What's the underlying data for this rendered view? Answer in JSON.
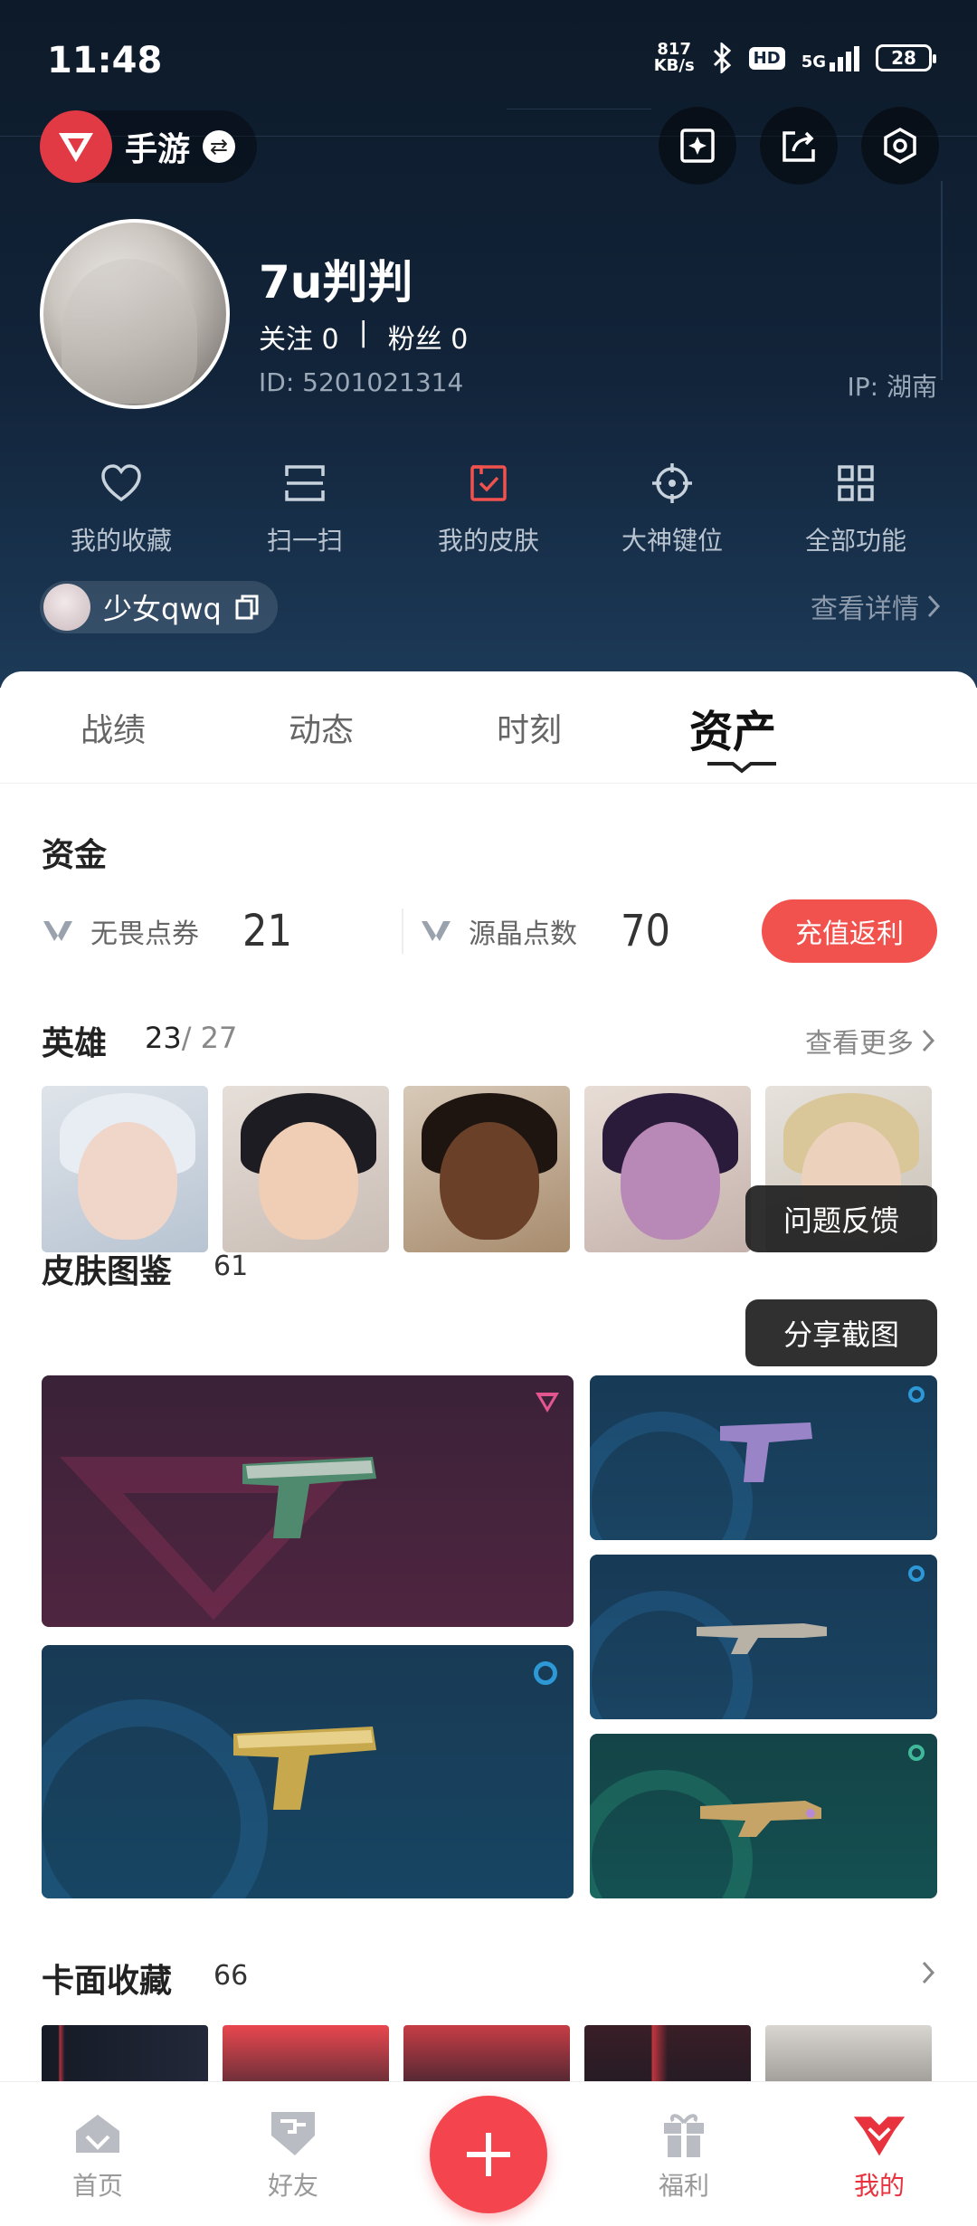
{
  "status_bar": {
    "time": "11:48",
    "net_speed_value": "817",
    "net_speed_unit": "KB/s",
    "hd": "HD",
    "network": "5G",
    "battery": "28"
  },
  "app_switcher": {
    "name": "手游"
  },
  "profile": {
    "username": "7u判判",
    "follow_label": "关注 0",
    "separator": "|",
    "fans_label": "粉丝 0",
    "id_text": "ID: 5201021314",
    "ip_text": "IP: 湖南"
  },
  "quick_menu": [
    {
      "label": "我的收藏"
    },
    {
      "label": "扫一扫"
    },
    {
      "label": "我的皮肤"
    },
    {
      "label": "大神键位"
    },
    {
      "label": "全部功能"
    }
  ],
  "role": {
    "name": "少女qwq"
  },
  "detail_link": "查看详情",
  "tabs": [
    {
      "label": "战绩"
    },
    {
      "label": "动态"
    },
    {
      "label": "时刻"
    },
    {
      "label": "资产"
    }
  ],
  "funds": {
    "title": "资金",
    "items": [
      {
        "label": "无畏点券",
        "value": "21"
      },
      {
        "label": "源晶点数",
        "value": "70"
      }
    ],
    "recharge_label": "充值返利"
  },
  "heroes": {
    "title": "英雄",
    "count": "23",
    "total": "/ 27",
    "see_more": "查看更多"
  },
  "skins": {
    "title": "皮肤图鉴",
    "count": "61"
  },
  "cards": {
    "title": "卡面收藏",
    "count": "66"
  },
  "floating": {
    "feedback": "问题反馈",
    "share": "分享截图"
  },
  "bottom_nav": [
    {
      "label": "首页"
    },
    {
      "label": "好友"
    },
    {
      "label": ""
    },
    {
      "label": "福利"
    },
    {
      "label": "我的"
    }
  ],
  "colors": {
    "accent": "#f2524e",
    "header_bg": "#12243a",
    "active_nav": "#e8323d"
  }
}
